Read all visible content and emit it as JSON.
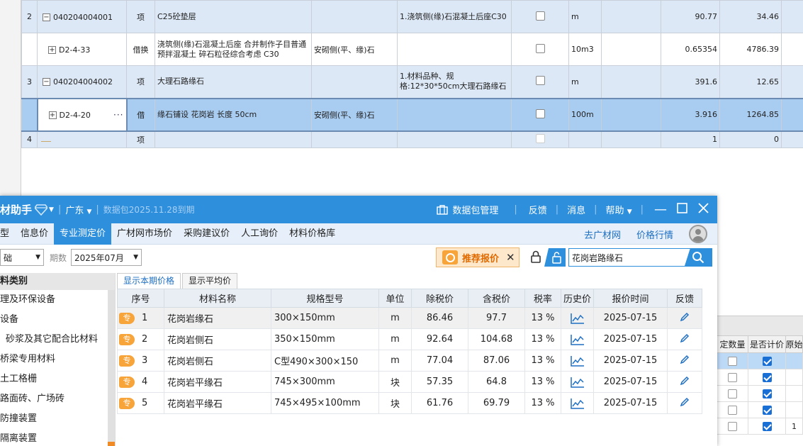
{
  "bg_rows": [
    {
      "seq": "2",
      "code": "040204004001",
      "tree": "minus",
      "type": "项",
      "name": "C25砼垫层",
      "spec": "",
      "feature": "1.浇筑侧(缘)石混凝土后座C30",
      "unit": "m",
      "qty": "90.77",
      "price": "34.46"
    },
    {
      "seq": "",
      "code": "D2-4-33",
      "tree": "plus",
      "type": "借换",
      "name": "浇筑侧(缘)石混凝土后座  合并制作子目普通预拌混凝土 碎石粒径综合考虑 C30",
      "spec": "安砌侧(平、缘)石",
      "feature": "",
      "unit": "10m3",
      "qty": "0.65354",
      "price": "4786.39"
    },
    {
      "seq": "3",
      "code": "040204004002",
      "tree": "minus",
      "type": "项",
      "name": "大理石路缘石",
      "spec": "",
      "feature": "1.材料品种、规格:12*30*50cm大理石路缘石",
      "unit": "m",
      "qty": "391.6",
      "price": "12.65"
    },
    {
      "seq": "",
      "code": "D2-4-20",
      "tree": "plus",
      "type": "借",
      "name": "缘石铺设 花岗岩 长度 50cm",
      "spec": "安砌侧(平、缘)石",
      "feature": "",
      "unit": "100m",
      "qty": "3.916",
      "price": "1264.85"
    },
    {
      "seq": "4",
      "code": "",
      "tree": "",
      "type": "项",
      "name": "",
      "spec": "",
      "feature": "",
      "unit": "",
      "qty": "1",
      "price": "0"
    }
  ],
  "right_fragment": {
    "headers": [
      "定数量",
      "是否计价",
      "原始"
    ],
    "rows": [
      {
        "checked": true
      },
      {
        "checked": true
      },
      {
        "checked": true
      },
      {
        "checked": true
      },
      {
        "checked": true,
        "extra": "1"
      }
    ]
  },
  "titlebar": {
    "title": "材助手",
    "region": "广东",
    "package": "数据包2025.11.28到期",
    "pkg_manage": "数据包管理",
    "feedback": "反馈",
    "messages": "消息",
    "help": "帮助"
  },
  "nav": {
    "items": [
      "型",
      "信息价",
      "专业测定价",
      "广材网市场价",
      "采购建议价",
      "人工询价",
      "材料价格库"
    ],
    "active_index": 2,
    "right": [
      "去广材网",
      "价格行情"
    ]
  },
  "filter": {
    "select1": "础",
    "period_label": "期数",
    "period_value": "2025年07月",
    "reco_label": "推荐报价",
    "search_value": "花岗岩路缘石"
  },
  "sidebar": {
    "header": "料类别",
    "items": [
      "理及环保设备",
      "设备",
      "砂浆及其它配合比材料",
      "桥梁专用材料",
      "土工格栅",
      "路面砖、广场砖",
      "防撞装置",
      "隔离装置"
    ]
  },
  "tabs": [
    "显示本期价格",
    "显示平均价"
  ],
  "grid": {
    "headers": [
      "序号",
      "材料名称",
      "规格型号",
      "单位",
      "除税价",
      "含税价",
      "税率",
      "历史价",
      "报价时间",
      "反馈"
    ],
    "badge": "专",
    "rows": [
      {
        "no": "1",
        "name": "花岗岩缘石",
        "spec": "300×150mm",
        "unit": "m",
        "excl": "86.46",
        "incl": "97.7",
        "tax": "13 %",
        "date": "2025-07-15"
      },
      {
        "no": "2",
        "name": "花岗岩侧石",
        "spec": "350×150mm",
        "unit": "m",
        "excl": "92.64",
        "incl": "104.68",
        "tax": "13 %",
        "date": "2025-07-15"
      },
      {
        "no": "3",
        "name": "花岗岩侧石",
        "spec": "C型490×300×150",
        "unit": "m",
        "excl": "77.04",
        "incl": "87.06",
        "tax": "13 %",
        "date": "2025-07-15"
      },
      {
        "no": "4",
        "name": "花岗岩平缘石",
        "spec": "745×300mm",
        "unit": "块",
        "excl": "57.35",
        "incl": "64.8",
        "tax": "13 %",
        "date": "2025-07-15"
      },
      {
        "no": "5",
        "name": "花岗岩平缘石",
        "spec": "745×495×100mm",
        "unit": "块",
        "excl": "61.76",
        "incl": "69.79",
        "tax": "13 %",
        "date": "2025-07-15"
      }
    ]
  },
  "colors": {
    "accent": "#2e8fdc",
    "badge": "#f7a43a",
    "row_alt": "#dde8f6",
    "row_selected": "#a9ccf1"
  }
}
